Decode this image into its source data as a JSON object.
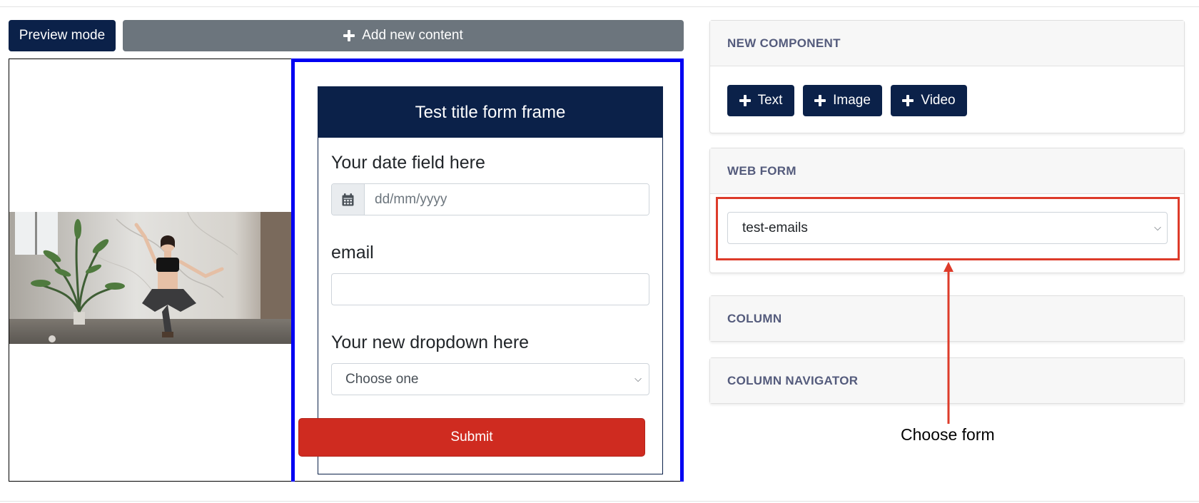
{
  "toolbar": {
    "preview_label": "Preview mode",
    "add_content_label": "Add new content"
  },
  "canvas": {
    "image_icon": "yoga-photo",
    "form": {
      "title": "Test title form frame",
      "date_label": "Your date field here",
      "date_placeholder": "dd/mm/yyyy",
      "date_icon": "calendar-icon",
      "email_label": "email",
      "email_value": "",
      "dropdown_label": "Your new dropdown here",
      "dropdown_value": "Choose one",
      "submit_label": "Submit"
    }
  },
  "sidebar": {
    "new_component": {
      "title": "NEW COMPONENT",
      "buttons": [
        "Text",
        "Image",
        "Video"
      ]
    },
    "web_form": {
      "title": "WEB FORM",
      "selected": "test-emails"
    },
    "column": {
      "title": "COLUMN"
    },
    "column_navigator": {
      "title": "COLUMN NAVIGATOR"
    }
  },
  "annotation": {
    "label": "Choose form"
  },
  "colors": {
    "navy": "#0b2149",
    "gray_button": "#6c757d",
    "selection_border": "#0000f2",
    "submit": "#cf2b20",
    "annotation": "#dd3b2a"
  }
}
